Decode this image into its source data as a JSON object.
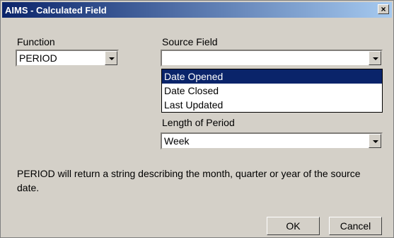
{
  "window": {
    "title": "AIMS - Calculated Field",
    "close_glyph": "×"
  },
  "function": {
    "label": "Function",
    "value": "PERIOD"
  },
  "source_field": {
    "label": "Source Field",
    "value": "",
    "options": [
      "Date Opened",
      "Date Closed",
      "Last Updated"
    ],
    "highlighted": "Date Opened"
  },
  "length_of_period": {
    "label": "Length of Period",
    "value": "Week"
  },
  "description": "PERIOD will return a string describing the month, quarter or year of the source date.",
  "buttons": {
    "ok": "OK",
    "cancel": "Cancel"
  },
  "colors": {
    "title_bar_start": "#0a246a",
    "title_bar_end": "#a6caf0",
    "selection": "#0a246a",
    "dialog_face": "#d4d0c8"
  },
  "icons": {
    "dropdown": "chevron-down-icon",
    "close": "close-icon"
  }
}
